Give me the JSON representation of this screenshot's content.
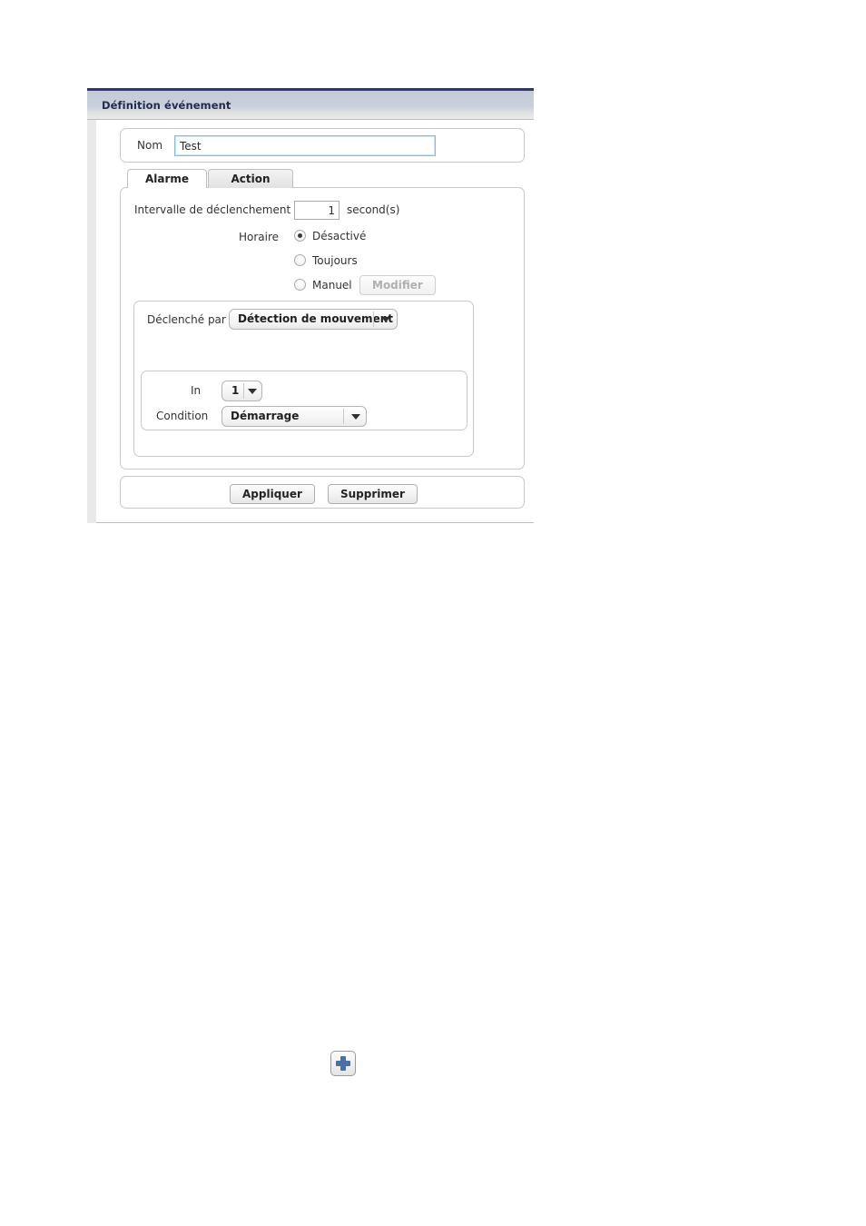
{
  "window": {
    "title": "Définition événement"
  },
  "form": {
    "name_label": "Nom",
    "name_value": "Test"
  },
  "tabs": [
    {
      "label": "Alarme",
      "active": true
    },
    {
      "label": "Action",
      "active": false
    }
  ],
  "alarm": {
    "interval_label": "Intervalle de déclenchement",
    "interval_value": "1",
    "interval_unit": "second(s)",
    "schedule_label": "Horaire",
    "schedule_options": [
      {
        "label": "Désactivé",
        "selected": true
      },
      {
        "label": "Toujours",
        "selected": false
      },
      {
        "label": "Manuel",
        "selected": false
      }
    ],
    "modify_button": "Modifier",
    "trigger_label": "Déclenché par",
    "trigger_value": "Détection de mouvement",
    "in_label": "In",
    "in_value": "1",
    "condition_label": "Condition",
    "condition_value": "Démarrage"
  },
  "footer": {
    "apply_label": "Appliquer",
    "delete_label": "Supprimer"
  },
  "add_button": {
    "icon": "plus-icon"
  },
  "colors": {
    "title_text": "#222b4d",
    "titlebar_top_border": "#2a3b73",
    "focus_border": "#7fbde4",
    "plus_icon": "#4a6fa8"
  }
}
